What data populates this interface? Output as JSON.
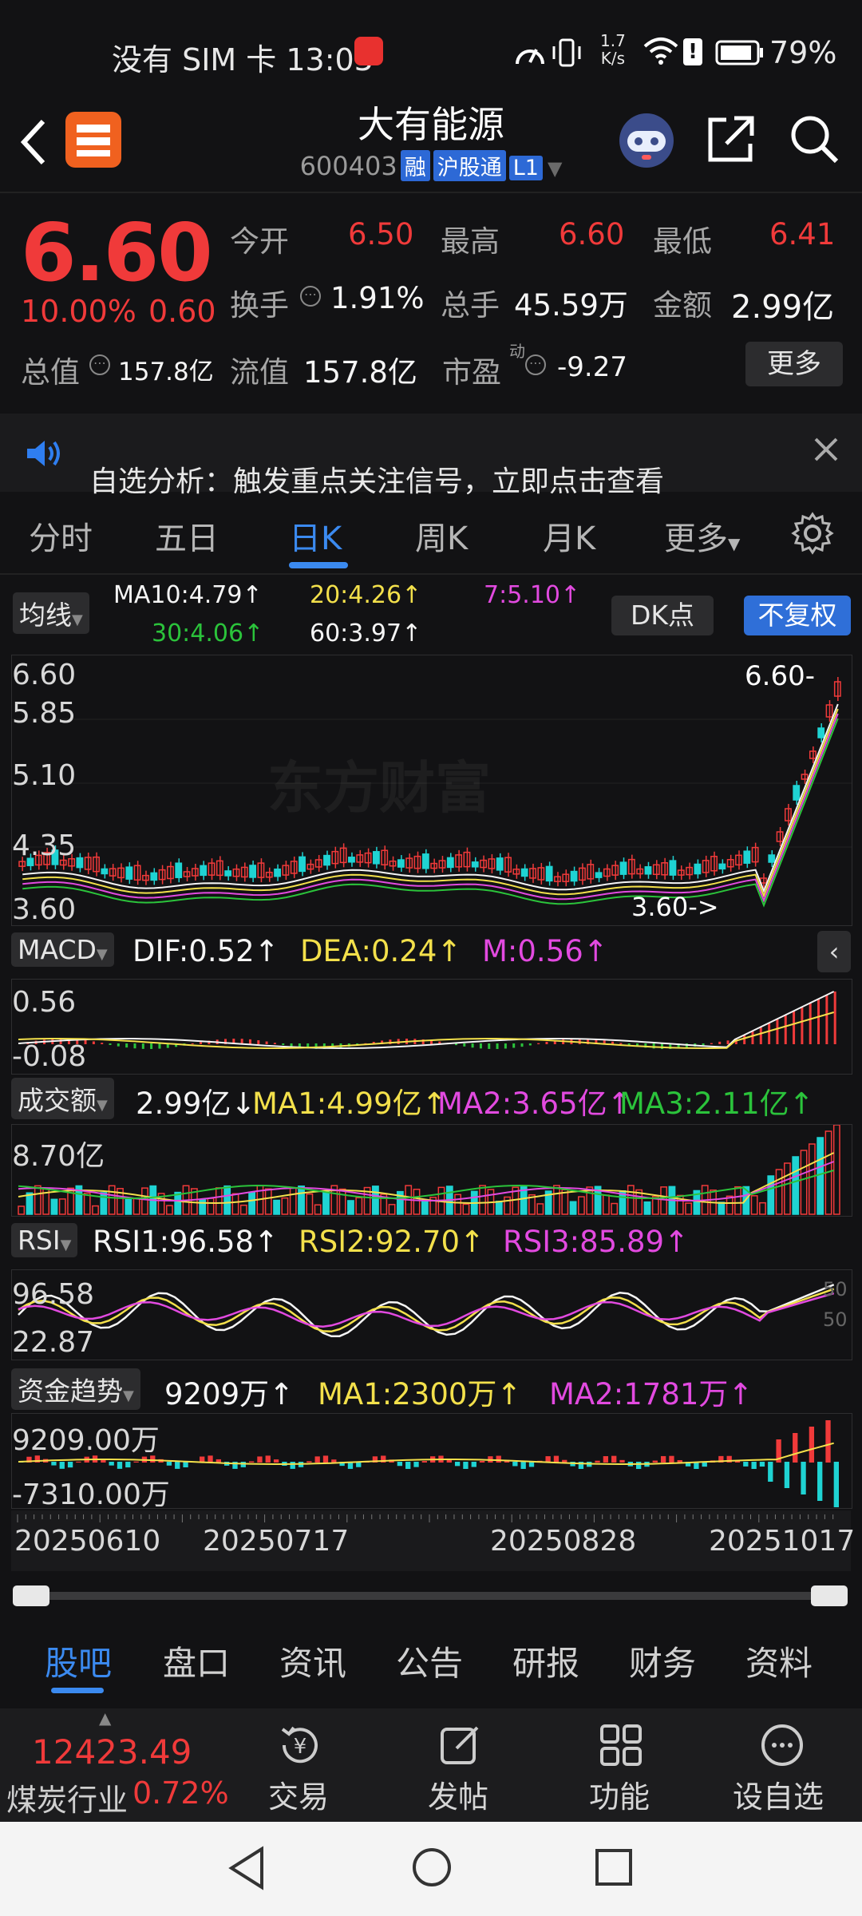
{
  "status": {
    "left": "没有 SIM 卡 13:03",
    "net_speed_top": "1.7",
    "net_speed_bot": "K/s",
    "battery": "79%"
  },
  "header": {
    "title": "大有能源",
    "code": "600403",
    "tags": [
      "融",
      "沪股通",
      "L1"
    ]
  },
  "quote": {
    "price": "6.60",
    "change_pct": "10.00%",
    "change": "0.60",
    "rows": [
      [
        {
          "label": "今开",
          "value": "6.50",
          "color": "#f03a3a"
        },
        {
          "label": "最高",
          "value": "6.60",
          "color": "#f03a3a"
        },
        {
          "label": "最低",
          "value": "6.41",
          "color": "#f03a3a"
        }
      ],
      [
        {
          "label": "换手",
          "value": "1.91%",
          "color": "#f0f0f0"
        },
        {
          "label": "总手",
          "value": "45.59万",
          "color": "#f0f0f0"
        },
        {
          "label": "金额",
          "value": "2.99亿",
          "color": "#f0f0f0"
        }
      ]
    ],
    "total_value_label": "总值",
    "total_value": "157.8亿",
    "float_value_label": "流值",
    "float_value": "157.8亿",
    "pe_label": "市盈",
    "pe_sup": "动",
    "pe_value": "-9.27",
    "more": "更多"
  },
  "notice": {
    "text": "自选分析：触发重点关注信号，立即点击查看"
  },
  "tabs": [
    "分时",
    "五日",
    "日K",
    "周K",
    "月K",
    "更多"
  ],
  "ma": {
    "selector": "均线",
    "ma10": "MA10:4.79↑",
    "ma20": "20:4.26↑",
    "ma7": "7:5.10↑",
    "ma30": "30:4.06↑",
    "ma60": "60:3.97↑",
    "dk_button": "DK点",
    "fq_button": "不复权"
  },
  "kline": {
    "y_labels": [
      "6.60",
      "5.85",
      "5.10",
      "4.35",
      "3.60"
    ],
    "last_label": "6.60-",
    "low_label": "3.60->",
    "watermark": "东方财富"
  },
  "macd": {
    "selector": "MACD",
    "dif": "DIF:0.52↑",
    "dea": "DEA:0.24↑",
    "m": "M:0.56↑",
    "y_top": "0.56",
    "y_bot": "-0.08"
  },
  "volume": {
    "selector": "成交额",
    "cur": "2.99亿↓",
    "ma1": "MA1:4.99亿↑",
    "ma2": "MA2:3.65亿↑",
    "ma3": "MA3:2.11亿↑",
    "y_top": "8.70亿"
  },
  "rsi": {
    "selector": "RSI",
    "rsi1": "RSI1:96.58↑",
    "rsi2": "RSI2:92.70↑",
    "rsi3": "RSI3:85.89↑",
    "y_top": "96.58",
    "y_bot": "22.87",
    "ref_high": "50",
    "ref_low": "50"
  },
  "funds": {
    "selector": "资金趋势",
    "cur": "9209万↑",
    "ma1": "MA1:2300万↑",
    "ma2": "MA2:1781万↑",
    "y_top": "9209.00万",
    "y_bot": "-7310.00万"
  },
  "dates": [
    "20250610",
    "20250717",
    "20250828",
    "20251017"
  ],
  "bottom_tabs": [
    "股吧",
    "盘口",
    "资讯",
    "公告",
    "研报",
    "财务",
    "资料"
  ],
  "bottom_bar": {
    "index_value": "12423.49",
    "index_name": "煤炭行业",
    "index_pct": "0.72%",
    "actions": [
      "交易",
      "发帖",
      "功能",
      "设自选"
    ]
  }
}
